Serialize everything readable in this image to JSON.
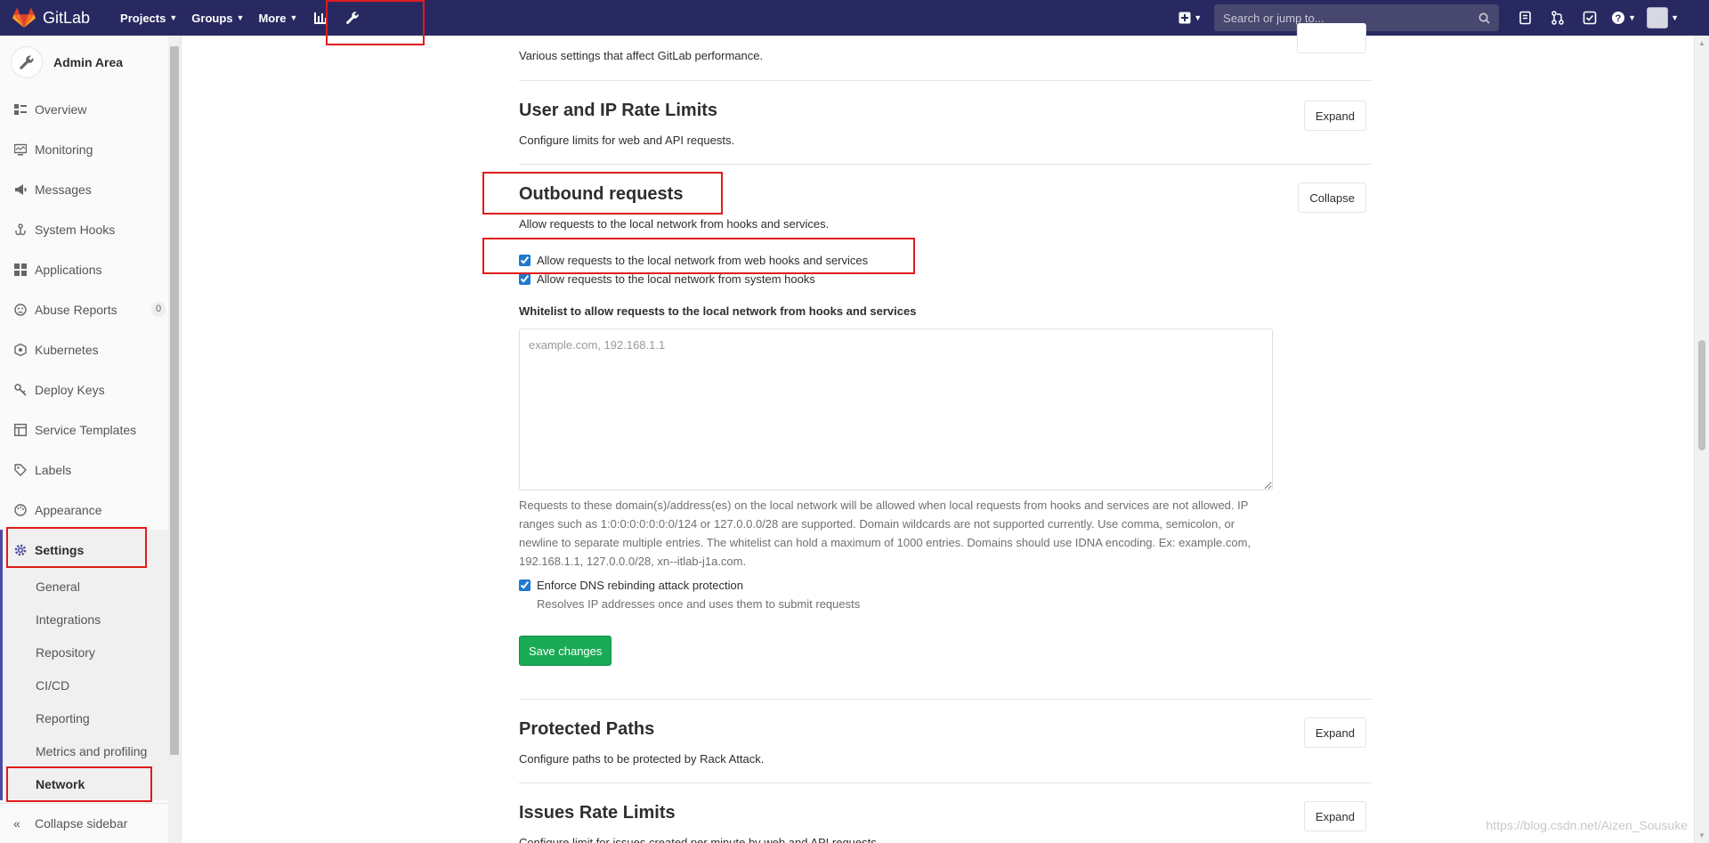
{
  "navbar": {
    "brand": "GitLab",
    "menu": [
      {
        "label": "Projects"
      },
      {
        "label": "Groups"
      },
      {
        "label": "More"
      }
    ],
    "search_placeholder": "Search or jump to...",
    "bg_color": "#292961"
  },
  "sidebar": {
    "context_title": "Admin Area",
    "items": [
      {
        "label": "Overview",
        "icon": "overview-icon"
      },
      {
        "label": "Monitoring",
        "icon": "monitor-icon"
      },
      {
        "label": "Messages",
        "icon": "messages-icon"
      },
      {
        "label": "System Hooks",
        "icon": "hook-icon"
      },
      {
        "label": "Applications",
        "icon": "applications-icon"
      },
      {
        "label": "Abuse Reports",
        "icon": "abuse-icon",
        "badge": "0"
      },
      {
        "label": "Kubernetes",
        "icon": "kubernetes-icon"
      },
      {
        "label": "Deploy Keys",
        "icon": "key-icon"
      },
      {
        "label": "Service Templates",
        "icon": "template-icon"
      },
      {
        "label": "Labels",
        "icon": "label-icon"
      },
      {
        "label": "Appearance",
        "icon": "appearance-icon"
      },
      {
        "label": "Settings",
        "icon": "settings-icon"
      }
    ],
    "settings_subitems": [
      {
        "label": "General"
      },
      {
        "label": "Integrations"
      },
      {
        "label": "Repository"
      },
      {
        "label": "CI/CD"
      },
      {
        "label": "Reporting"
      },
      {
        "label": "Metrics and profiling"
      },
      {
        "label": "Network"
      }
    ],
    "collapse_label": "Collapse sidebar"
  },
  "sections": {
    "performance": {
      "desc": "Various settings that affect GitLab performance."
    },
    "rate_limits": {
      "title": "User and IP Rate Limits",
      "desc": "Configure limits for web and API requests.",
      "button": "Expand"
    },
    "outbound": {
      "title": "Outbound requests",
      "desc": "Allow requests to the local network from hooks and services.",
      "button": "Collapse",
      "cb_web_hooks": "Allow requests to the local network from web hooks and services",
      "cb_system_hooks": "Allow requests to the local network from system hooks",
      "whitelist_label": "Whitelist to allow requests to the local network from hooks and services",
      "whitelist_placeholder": "example.com, 192.168.1.1",
      "help": "Requests to these domain(s)/address(es) on the local network will be allowed when local requests from hooks and services are not allowed. IP ranges such as 1:0:0:0:0:0:0:0/124 or 127.0.0.0/28 are supported. Domain wildcards are not supported currently. Use comma, semicolon, or newline to separate multiple entries. The whitelist can hold a maximum of 1000 entries. Domains should use IDNA encoding. Ex: example.com, 192.168.1.1, 127.0.0.0/28, xn--itlab-j1a.com.",
      "cb_dns": "Enforce DNS rebinding attack protection",
      "dns_help": "Resolves IP addresses once and uses them to submit requests",
      "save": "Save changes"
    },
    "protected_paths": {
      "title": "Protected Paths",
      "desc": "Configure paths to be protected by Rack Attack.",
      "button": "Expand"
    },
    "issues_rate": {
      "title": "Issues Rate Limits",
      "desc": "Configure limit for issues created per minute by web and API requests.",
      "button": "Expand"
    }
  },
  "watermark": "https://blog.csdn.net/Aizen_Sousuke",
  "colors": {
    "highlight": "#e01b1b",
    "success": "#1aaa55"
  }
}
